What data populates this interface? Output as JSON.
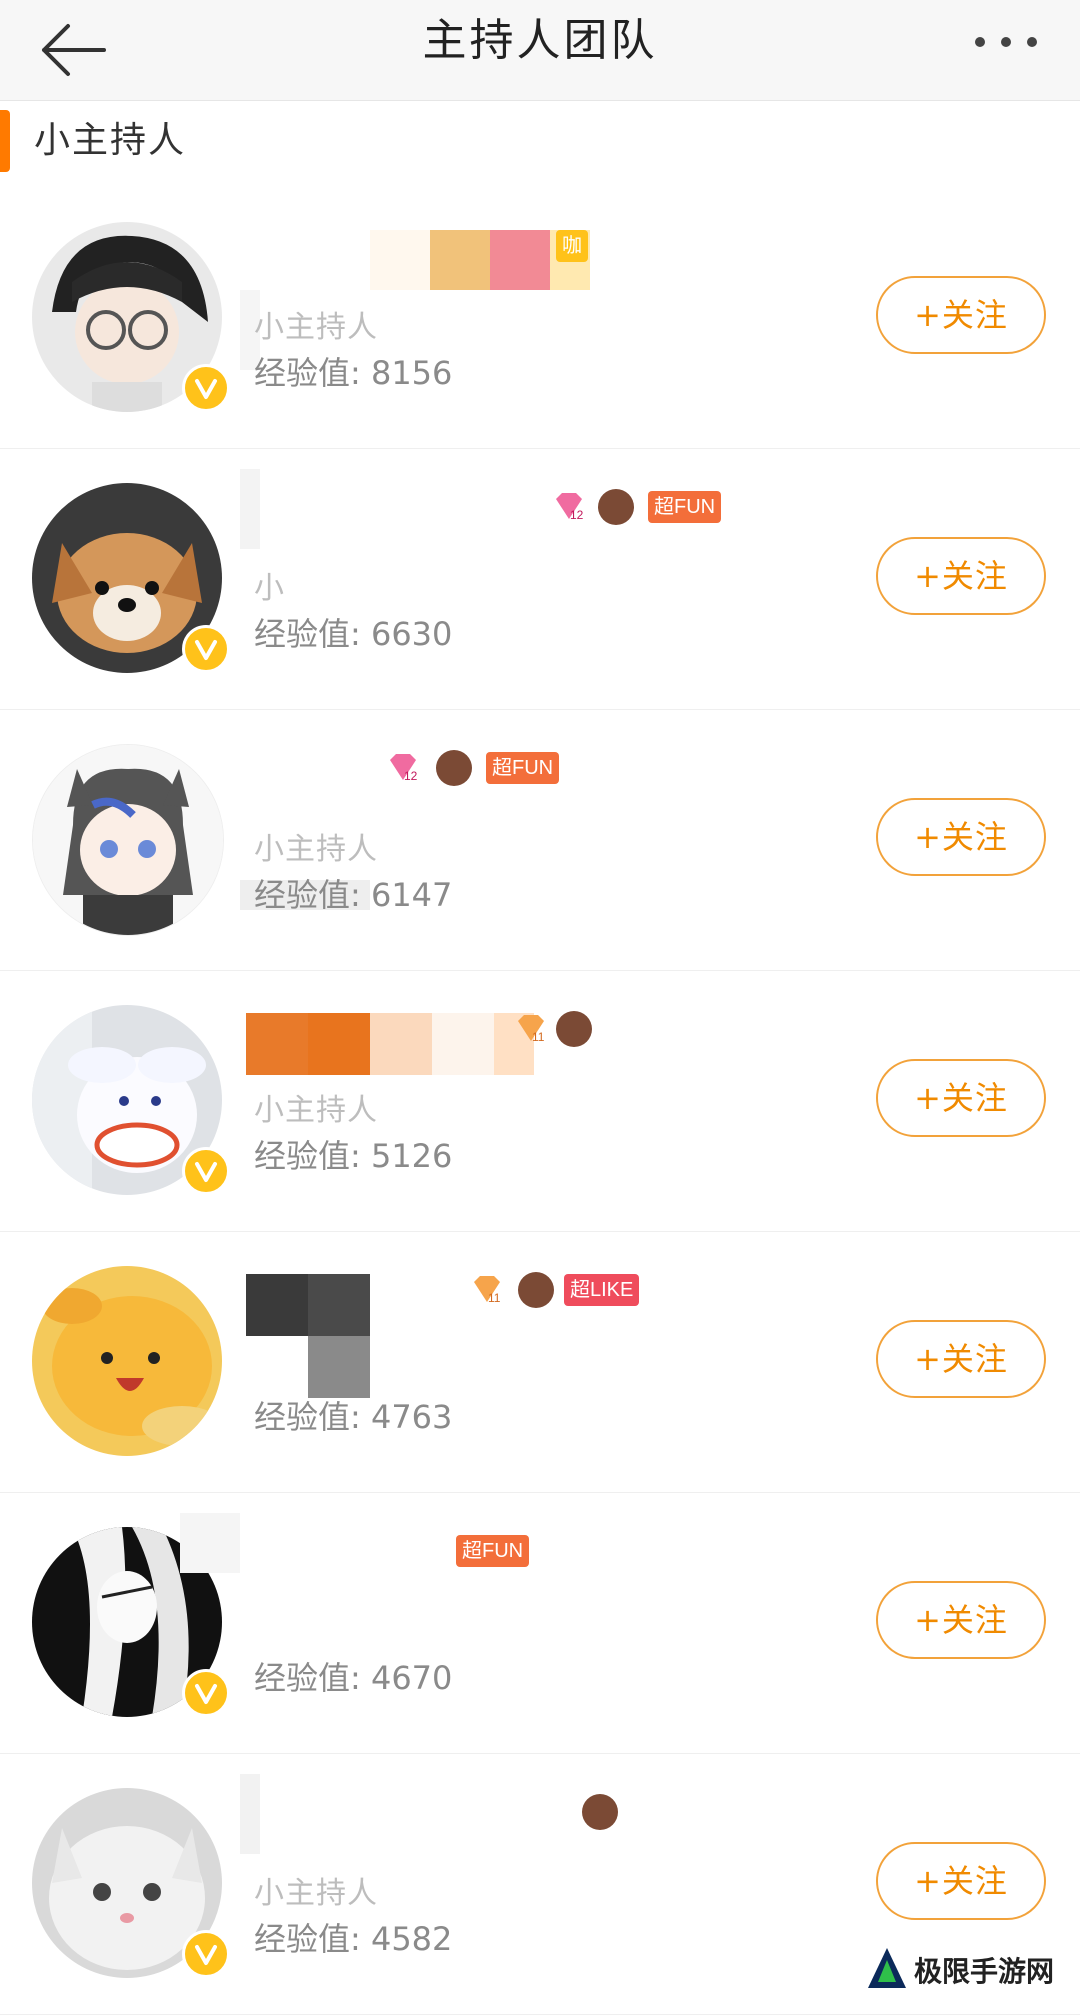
{
  "header": {
    "title": "主持人团队",
    "back_icon": "arrow-left-icon",
    "more_icon": "more-dots-icon"
  },
  "section": {
    "label": "小主持人"
  },
  "accent_color": "#ff7a00",
  "follow_color": "#f08a00",
  "members": [
    {
      "role": "小主持人",
      "exp": "经验值: 8156",
      "follow_label": "+关注",
      "verified": true,
      "badges": [
        "咖"
      ]
    },
    {
      "role": "小",
      "exp": "经验值: 6630",
      "follow_label": "+关注",
      "verified": true,
      "badges": [
        "gem-12",
        "lion",
        "超FUN"
      ]
    },
    {
      "role": "小主持人",
      "exp": "经验值: 6147",
      "follow_label": "+关注",
      "verified": false,
      "badges": [
        "gem-12",
        "lion",
        "超FUN"
      ]
    },
    {
      "role": "小主持人",
      "exp": "经验值: 5126",
      "follow_label": "+关注",
      "verified": true,
      "badges": [
        "gem-11",
        "lion"
      ]
    },
    {
      "role": "",
      "exp": "经验值: 4763",
      "follow_label": "+关注",
      "verified": false,
      "badges": [
        "gem-11",
        "lion",
        "超LIKE"
      ]
    },
    {
      "role": "",
      "exp": "经验值: 4670",
      "follow_label": "+关注",
      "verified": true,
      "badges": [
        "超FUN"
      ]
    },
    {
      "role": "小主持人",
      "exp": "经验值: 4582",
      "follow_label": "+关注",
      "verified": true,
      "badges": [
        "lion"
      ]
    }
  ],
  "badge_text": {
    "fun": "超FUN",
    "like": "超LIKE",
    "ka": "咖"
  },
  "watermark": {
    "text": "极限手游网"
  }
}
